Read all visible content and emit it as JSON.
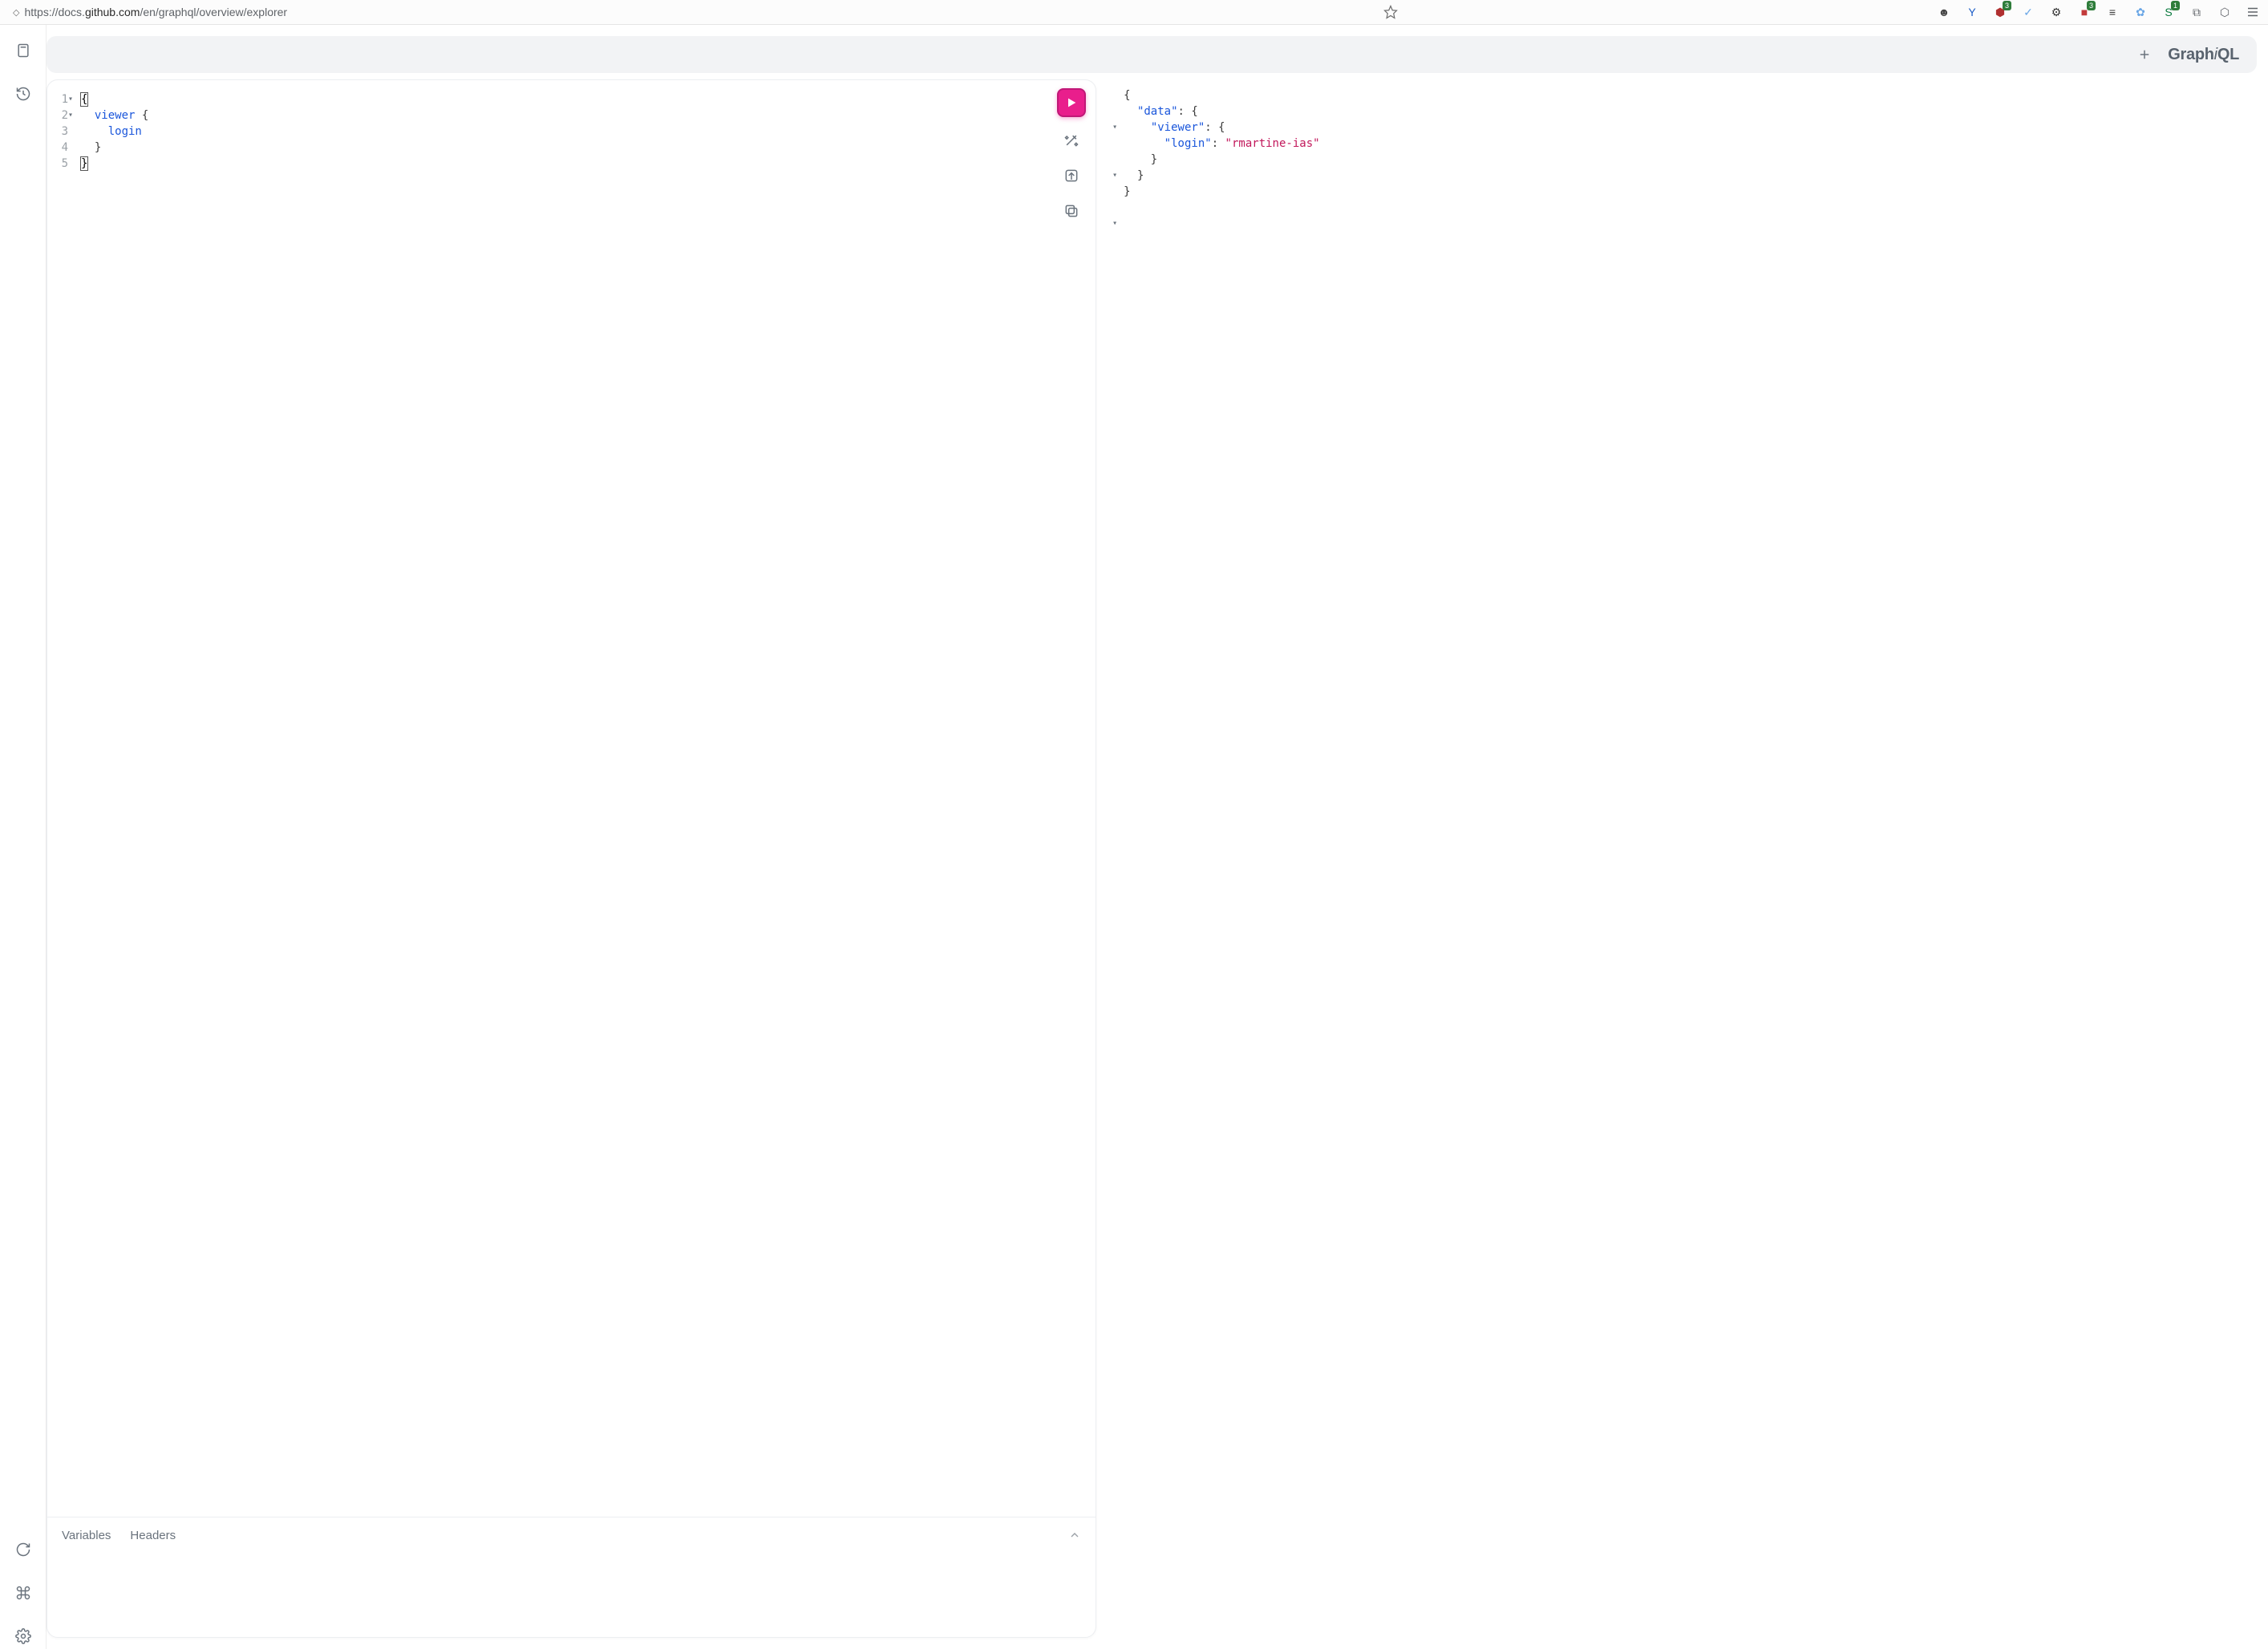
{
  "browser": {
    "url_prefix": "https://docs.",
    "url_bold": "github.com",
    "url_suffix": "/en/graphql/overview/explorer",
    "extensions": [
      {
        "name": "user-icon",
        "glyph": "☻",
        "color": "#444",
        "badge": ""
      },
      {
        "name": "filter-icon",
        "glyph": "Y",
        "color": "#1b5cc7",
        "badge": ""
      },
      {
        "name": "shield-icon",
        "glyph": "⬢",
        "color": "#b03030",
        "badge": "3"
      },
      {
        "name": "check-circle-icon",
        "glyph": "✓",
        "color": "#6aa6e6",
        "badge": ""
      },
      {
        "name": "gear-icon",
        "glyph": "⚙",
        "color": "#333",
        "badge": ""
      },
      {
        "name": "app-icon",
        "glyph": "■",
        "color": "#c23b3b",
        "badge": "3"
      },
      {
        "name": "bars-icon",
        "glyph": "≡",
        "color": "#3a3a3a",
        "badge": ""
      },
      {
        "name": "butterfly-icon",
        "glyph": "✿",
        "color": "#6aa6e6",
        "badge": ""
      },
      {
        "name": "s-icon",
        "glyph": "S",
        "color": "#0a7a3f",
        "badge": "1"
      },
      {
        "name": "puzzle-icon",
        "glyph": "⧉",
        "color": "#5f6368",
        "badge": ""
      },
      {
        "name": "hex-icon",
        "glyph": "⬡",
        "color": "#5f6368",
        "badge": ""
      }
    ]
  },
  "topbar": {
    "logo_part1": "Graph",
    "logo_i": "i",
    "logo_part2": "QL"
  },
  "editor": {
    "lines": {
      "l1": "{",
      "l2a": "  ",
      "l2b": "viewer",
      "l2c": " {",
      "l3a": "    ",
      "l3b": "login",
      "l4": "  }",
      "l5": "}"
    },
    "gutter": [
      "1",
      "2",
      "3",
      "4",
      "5"
    ],
    "folds": [
      "▾",
      "▾",
      "",
      "",
      ""
    ],
    "footer": {
      "tab_variables": "Variables",
      "tab_headers": "Headers"
    }
  },
  "response": {
    "folds": [
      "▾",
      "▾",
      "▾",
      "",
      "",
      "",
      ""
    ],
    "l1": "{",
    "l2a": "  ",
    "l2b": "\"data\"",
    "l2c": ": {",
    "l3a": "    ",
    "l3b": "\"viewer\"",
    "l3c": ": {",
    "l4a": "      ",
    "l4b": "\"login\"",
    "l4c": ": ",
    "l4d": "\"rmartine-ias\"",
    "l5": "    }",
    "l6": "  }",
    "l7": "}"
  }
}
